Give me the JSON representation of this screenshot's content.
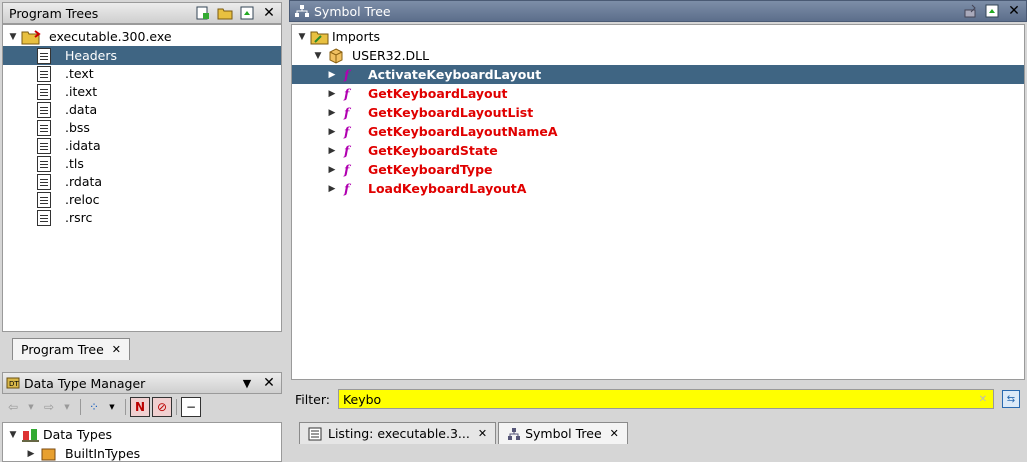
{
  "program_trees": {
    "title": "Program Trees",
    "root": "executable.300.exe",
    "sections": [
      "Headers",
      ".text",
      ".itext",
      ".data",
      ".bss",
      ".idata",
      ".tls",
      ".rdata",
      ".reloc",
      ".rsrc"
    ],
    "tab_label": "Program Tree"
  },
  "symbol_tree": {
    "title": "Symbol Tree",
    "imports_label": "Imports",
    "dll_label": "USER32.DLL",
    "functions": [
      "ActivateKeyboardLayout",
      "GetKeyboardLayout",
      "GetKeyboardLayoutList",
      "GetKeyboardLayoutNameA",
      "GetKeyboardState",
      "GetKeyboardType",
      "LoadKeyboardLayoutA"
    ],
    "selected_index": 0,
    "filter_label": "Filter:",
    "filter_value": "Keybo"
  },
  "data_type_manager": {
    "title": "Data Type Manager",
    "root": "Data Types",
    "child": "BuiltInTypes"
  },
  "bottom_tabs": [
    {
      "label": "Listing:  executable.3..."
    },
    {
      "label": "Symbol Tree"
    }
  ],
  "colors": {
    "selection": "#3f6583",
    "function_text": "#e00000",
    "filter_bg": "#ffff00"
  },
  "icons": {
    "close": "✕"
  }
}
